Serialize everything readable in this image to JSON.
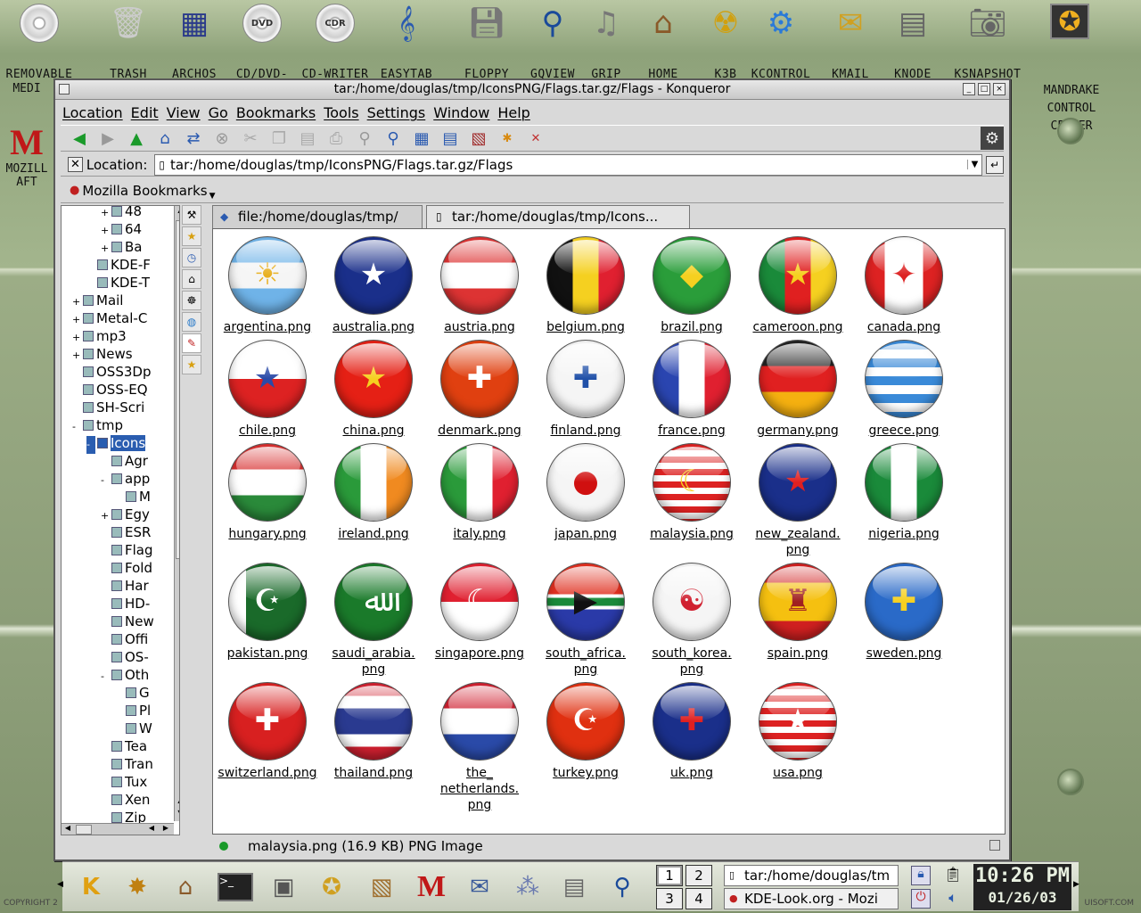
{
  "desktop": {
    "icons": [
      {
        "label": "REMOVABLE",
        "icon": "disc-icon"
      },
      {
        "label": "TRASH",
        "icon": "trash-icon"
      },
      {
        "label": "ARCHOS",
        "icon": "archos-icon"
      },
      {
        "label": "CD/DVD-",
        "icon": "dvd-icon"
      },
      {
        "label": "CD-WRITER",
        "icon": "cdr-icon"
      },
      {
        "label": "EASYTAB",
        "icon": "music-clef-icon"
      },
      {
        "label": "FLOPPY",
        "icon": "floppy-icon"
      },
      {
        "label": "GQVIEW",
        "icon": "magnifier-icon"
      },
      {
        "label": "GRIP",
        "icon": "music-notes-icon"
      },
      {
        "label": "HOME",
        "icon": "home-icon"
      },
      {
        "label": "K3B",
        "icon": "radiation-icon"
      },
      {
        "label": "KCONTROL",
        "icon": "gear-icon"
      },
      {
        "label": "KMAIL",
        "icon": "mail-icon"
      },
      {
        "label": "KNODE",
        "icon": "newspaper-icon"
      },
      {
        "label": "KSNAPSHOT",
        "icon": "camera-icon"
      },
      {
        "label": "MANDRAKE CONTROL CENTER",
        "icon": "mandrake-icon"
      }
    ],
    "left_icons": [
      {
        "label": "MEDI",
        "icon": "none"
      },
      {
        "label": "MOZILL",
        "icon": "mozilla-icon"
      },
      {
        "label": "AFT",
        "icon": "none"
      }
    ],
    "footer_left": "COPYRIGHT 2",
    "footer_right": "UISOFT.COM"
  },
  "window": {
    "title": "tar:/home/douglas/tmp/IconsPNG/Flags.tar.gz/Flags - Konqueror",
    "menu": [
      "Location",
      "Edit",
      "View",
      "Go",
      "Bookmarks",
      "Tools",
      "Settings",
      "Window",
      "Help"
    ],
    "location_label": "Location:",
    "location_value": "tar:/home/douglas/tmp/IconsPNG/Flags.tar.gz/Flags",
    "bookmarks_label": "Mozilla Bookmarks",
    "tabs": [
      {
        "label": "file:/home/douglas/tmp/",
        "active": false
      },
      {
        "label": "tar:/home/douglas/tmp/Icons...",
        "active": true
      }
    ],
    "status_text": "malaysia.png (16.9 KB)  PNG Image"
  },
  "tree": [
    {
      "label": "48",
      "expander": "+",
      "depth": 4
    },
    {
      "label": "64",
      "expander": "+",
      "depth": 4
    },
    {
      "label": "Ba",
      "expander": "+",
      "depth": 4
    },
    {
      "label": "KDE-F",
      "expander": "",
      "depth": 3
    },
    {
      "label": "KDE-T",
      "expander": "",
      "depth": 3
    },
    {
      "label": "Mail",
      "expander": "+",
      "depth": 2
    },
    {
      "label": "Metal-C",
      "expander": "+",
      "depth": 2
    },
    {
      "label": "mp3",
      "expander": "+",
      "depth": 2
    },
    {
      "label": "News",
      "expander": "+",
      "depth": 2
    },
    {
      "label": "OSS3Dp",
      "expander": "",
      "depth": 2
    },
    {
      "label": "OSS-EQ",
      "expander": "",
      "depth": 2
    },
    {
      "label": "SH-Scri",
      "expander": "",
      "depth": 2
    },
    {
      "label": "tmp",
      "expander": "-",
      "depth": 2
    },
    {
      "label": "Icons",
      "expander": "-",
      "depth": 3,
      "selected": true
    },
    {
      "label": "Agr",
      "expander": "",
      "depth": 4
    },
    {
      "label": "app",
      "expander": "-",
      "depth": 4
    },
    {
      "label": "M",
      "expander": "",
      "depth": 5
    },
    {
      "label": "Egy",
      "expander": "+",
      "depth": 4
    },
    {
      "label": "ESR",
      "expander": "",
      "depth": 4
    },
    {
      "label": "Flag",
      "expander": "",
      "depth": 4
    },
    {
      "label": "Fold",
      "expander": "",
      "depth": 4
    },
    {
      "label": "Har",
      "expander": "",
      "depth": 4
    },
    {
      "label": "HD-",
      "expander": "",
      "depth": 4
    },
    {
      "label": "New",
      "expander": "",
      "depth": 4
    },
    {
      "label": "Offi",
      "expander": "",
      "depth": 4
    },
    {
      "label": "OS-",
      "expander": "",
      "depth": 4
    },
    {
      "label": "Oth",
      "expander": "-",
      "depth": 4
    },
    {
      "label": "G",
      "expander": "",
      "depth": 5
    },
    {
      "label": "Pl",
      "expander": "",
      "depth": 5
    },
    {
      "label": "W",
      "expander": "",
      "depth": 5
    },
    {
      "label": "Tea",
      "expander": "",
      "depth": 4
    },
    {
      "label": "Tran",
      "expander": "",
      "depth": 4
    },
    {
      "label": "Tux",
      "expander": "",
      "depth": 4
    },
    {
      "label": "Xen",
      "expander": "",
      "depth": 4
    },
    {
      "label": "Zip",
      "expander": "",
      "depth": 4
    }
  ],
  "files": [
    {
      "name": "argentina.png",
      "bg": "linear-gradient(#6fb3e8 0 33%,#f5f5f5 33% 67%,#6fb3e8 67%)",
      "emblem": "☀",
      "ec": "#e8b020"
    },
    {
      "name": "australia.png",
      "bg": "#1a2f8a",
      "emblem": "★",
      "ec": "#fff"
    },
    {
      "name": "austria.png",
      "bg": "linear-gradient(#d33 0 33%,#fff 33% 67%,#d33 67%)",
      "emblem": "",
      "ec": ""
    },
    {
      "name": "belgium.png",
      "bg": "linear-gradient(90deg,#111 0 33%,#f5d020 33% 67%,#e02030 67%)",
      "emblem": "",
      "ec": ""
    },
    {
      "name": "brazil.png",
      "bg": "#2a9d3a",
      "emblem": "◆",
      "ec": "#f5d020"
    },
    {
      "name": "cameroon.png",
      "bg": "linear-gradient(90deg,#1a8a3a 0 33%,#e02020 33% 67%,#f5d020 67%)",
      "emblem": "★",
      "ec": "#f5d020"
    },
    {
      "name": "canada.png",
      "bg": "linear-gradient(90deg,#d22 0 25%,#fff 25% 75%,#d22 75%)",
      "emblem": "✦",
      "ec": "#d22"
    },
    {
      "name": "chile.png",
      "bg": "linear-gradient(#fff 0 50%,#d22 50%)",
      "emblem": "★",
      "ec": "#2a4aa8"
    },
    {
      "name": "china.png",
      "bg": "#e52015",
      "emblem": "★",
      "ec": "#f5d020"
    },
    {
      "name": "denmark.png",
      "bg": "#e04010",
      "emblem": "✚",
      "ec": "#fff"
    },
    {
      "name": "finland.png",
      "bg": "#f5f5f5",
      "emblem": "✚",
      "ec": "#2050a8"
    },
    {
      "name": "france.png",
      "bg": "linear-gradient(90deg,#2a45b0 0 33%,#fff 33% 67%,#e02030 67%)",
      "emblem": "",
      "ec": ""
    },
    {
      "name": "germany.png",
      "bg": "linear-gradient(#222 0 33%,#e02020 33% 67%,#f5b010 67%)",
      "emblem": "",
      "ec": ""
    },
    {
      "name": "greece.png",
      "bg": "repeating-linear-gradient(#3a8ad8 0 10px,#fff 10px 20px)",
      "emblem": "",
      "ec": ""
    },
    {
      "name": "hungary.png",
      "bg": "linear-gradient(#d83030 0 33%,#fff 33% 67%,#2a8a3a 67%)",
      "emblem": "",
      "ec": ""
    },
    {
      "name": "ireland.png",
      "bg": "linear-gradient(90deg,#2a9a3a 0 33%,#fff 33% 67%,#f08a20 67%)",
      "emblem": "",
      "ec": ""
    },
    {
      "name": "italy.png",
      "bg": "linear-gradient(90deg,#2a9a3a 0 33%,#fff 33% 67%,#e02030 67%)",
      "emblem": "",
      "ec": ""
    },
    {
      "name": "japan.png",
      "bg": "#f5f5f5",
      "emblem": "●",
      "ec": "#d01010"
    },
    {
      "name": "malaysia.png",
      "bg": "repeating-linear-gradient(#d22 0 7px,#fff 7px 14px)",
      "emblem": "☾",
      "ec": "#f5d020"
    },
    {
      "name": "new_zealand.png",
      "bg": "#1a2f8a",
      "emblem": "★",
      "ec": "#e02020"
    },
    {
      "name": "nigeria.png",
      "bg": "linear-gradient(90deg,#1a8a3a 0 33%,#fff 33% 67%,#1a8a3a 67%)",
      "emblem": "",
      "ec": ""
    },
    {
      "name": "pakistan.png",
      "bg": "linear-gradient(90deg,#fff 0 22%,#1a6a2a 22%)",
      "emblem": "☪",
      "ec": "#fff"
    },
    {
      "name": "saudi_arabia.png",
      "bg": "#1a7a2a",
      "emblem": "ﷲ",
      "ec": "#fff"
    },
    {
      "name": "singapore.png",
      "bg": "linear-gradient(#e02030 0 50%,#fff 50%)",
      "emblem": "☾",
      "ec": "#fff"
    },
    {
      "name": "south_africa.png",
      "bg": "linear-gradient(#e03020 0 40%,#fff 40% 45%,#1a8a3a 45% 55%,#fff 55% 60%,#2a3aa8 60%)",
      "emblem": "▶",
      "ec": "#111"
    },
    {
      "name": "south_korea.png",
      "bg": "#f5f5f5",
      "emblem": "☯",
      "ec": "#d02030"
    },
    {
      "name": "spain.png",
      "bg": "linear-gradient(#d02020 0 25%,#f5c010 25% 75%,#d02020 75%)",
      "emblem": "♜",
      "ec": "#a02020"
    },
    {
      "name": "sweden.png",
      "bg": "#2a6ac8",
      "emblem": "✚",
      "ec": "#f5d020"
    },
    {
      "name": "switzerland.png",
      "bg": "#d82020",
      "emblem": "✚",
      "ec": "#fff"
    },
    {
      "name": "thailand.png",
      "bg": "linear-gradient(#d02030 0 17%,#fff 17% 33%,#2a3a90 33% 67%,#fff 67% 83%,#d02030 83%)",
      "emblem": "",
      "ec": ""
    },
    {
      "name": "the_netherlands.png",
      "bg": "linear-gradient(#d02030 0 33%,#fff 33% 67%,#2a4aa8 67%)",
      "emblem": "",
      "ec": ""
    },
    {
      "name": "turkey.png",
      "bg": "#e03010",
      "emblem": "☪",
      "ec": "#fff"
    },
    {
      "name": "uk.png",
      "bg": "#1a2f8a",
      "emblem": "✚",
      "ec": "#e02020"
    },
    {
      "name": "usa.png",
      "bg": "repeating-linear-gradient(#d22 0 7px,#fff 7px 14px)",
      "emblem": "★",
      "ec": "#fff"
    }
  ],
  "file_name_display": {
    "new_zealand.png": [
      "new_zealand.",
      "png"
    ],
    "saudi_arabia.png": [
      "saudi_arabia.",
      "png"
    ],
    "south_africa.png": [
      "south_africa.",
      "png"
    ],
    "south_korea.png": [
      "south_korea.",
      "png"
    ],
    "the_netherlands.png": [
      "the_",
      "netherlands.",
      "png"
    ]
  },
  "taskbar": {
    "desktops": [
      "1",
      "2",
      "3",
      "4"
    ],
    "active_desktop": "1",
    "tasks": [
      "tar:/home/douglas/tm",
      "KDE-Look.org - Mozi"
    ],
    "time": "10:26 PM",
    "date": "01/26/03"
  }
}
